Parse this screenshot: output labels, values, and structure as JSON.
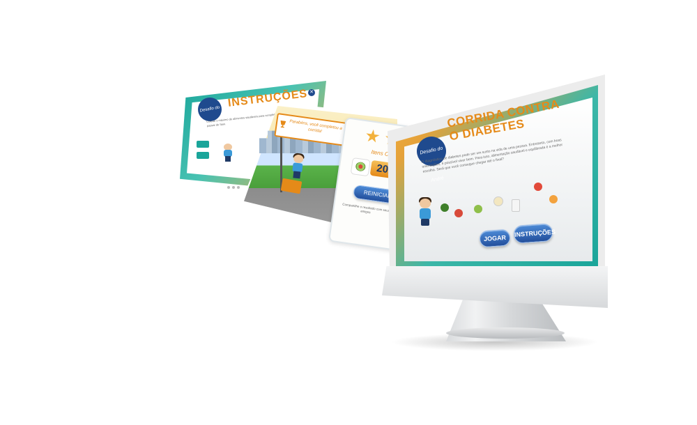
{
  "instructions_card": {
    "title": "INSTRUÇÕES",
    "badge": "Desafio do André",
    "close_label": "✕",
    "body_text": "Coletar o máximo de alimentos saudáveis para completar a corrida e passar de fase."
  },
  "results_card": {
    "finish_message": "Parabéns, você completou a corrida!",
    "collected_label": "Itens Coletados",
    "score": "20/20",
    "stars_earned": 3,
    "restart_label": "REINICIAR",
    "share_text": "Compartilhe o resultado com seus amigos",
    "share_icon": "f"
  },
  "main_screen": {
    "title_line1": "CORRIDA CONTRA",
    "title_line2": "O DIABETES",
    "badge": "Desafio do André",
    "intro_text": "O diagnóstico de diabetes pode ser um susto na vida de uma pessoa. Entretanto, com boas orientações, é possível viver bem. Para isso, alimentação saudável e equilibrada é a melhor escolha. Será que você consegue chegar até o final?",
    "play_label": "JOGAR",
    "instructions_label": "INSTRUÇÕES",
    "foods": [
      "broccoli",
      "tomato",
      "kiwi",
      "guava",
      "egg",
      "milk",
      "strawberry",
      "orange"
    ]
  },
  "colors": {
    "accent_orange": "#e58a19",
    "accent_teal": "#1aa59a",
    "button_blue": "#234f9c",
    "badge_navy": "#1f4a8e"
  }
}
